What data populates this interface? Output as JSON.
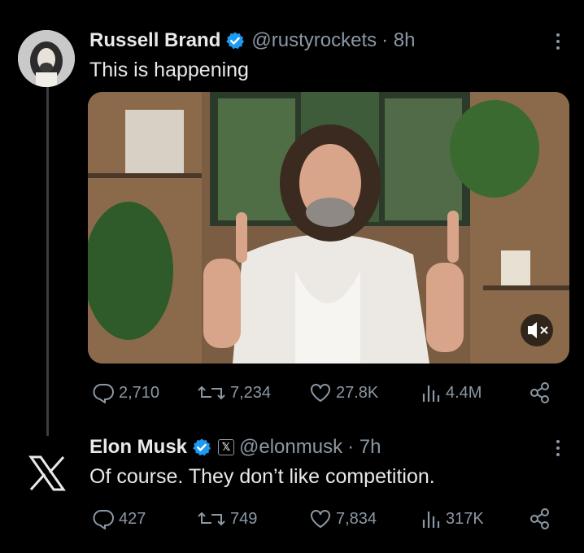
{
  "tweets": [
    {
      "name": "Russell Brand",
      "handle": "@rustyrockets",
      "time": "· 8h",
      "text": "This is happening",
      "stats": {
        "replies": "2,710",
        "reposts": "7,234",
        "likes": "27.8K",
        "views": "4.4M"
      }
    },
    {
      "name": "Elon Musk",
      "handle": "@elonmusk",
      "time": "· 7h",
      "text": "Of course. They don’t like competition.",
      "stats": {
        "replies": "427",
        "reposts": "749",
        "likes": "7,834",
        "views": "317K"
      }
    }
  ],
  "colors": {
    "background": "#000000",
    "verified": "#1d9bf0",
    "muted": "#8b98a5"
  }
}
